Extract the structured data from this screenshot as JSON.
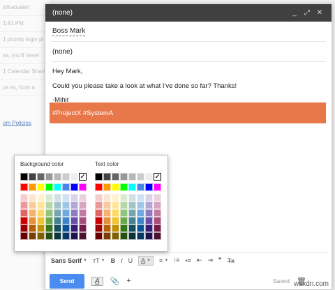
{
  "background": {
    "rows": [
      "Whatsalert",
      "1:41 PM",
      "1 pcomp login pl",
      "ss, you'll never",
      "1 Calendar Share",
      "ps ss, from a"
    ],
    "link": "om Policies"
  },
  "compose": {
    "title": "(none)",
    "to": "Boss Mark",
    "subject": "(none)",
    "body": [
      "Hey Mark,",
      "Could you please take a look at what I've done so far? Thanks!",
      "-Mihir"
    ],
    "highlighted_line": "#ProjectX #SystemA",
    "highlight_color": "#e8774a",
    "window_buttons": [
      "_",
      "⤢",
      "✕"
    ]
  },
  "picker": {
    "background_label": "Background color",
    "text_label": "Text color",
    "grays": [
      "#000000",
      "#434343",
      "#666666",
      "#999999",
      "#b7b7b7",
      "#cccccc",
      "#eeeeee",
      "CHECK"
    ],
    "text_grays": [
      "#000000",
      "#434343",
      "#666666",
      "#999999",
      "#b7b7b7",
      "#cccccc",
      "#eeeeee",
      "CHECK"
    ],
    "bright": [
      "#ff0000",
      "#ff9900",
      "#ffff00",
      "#00ff00",
      "#00ffff",
      "#4a86e8",
      "#0000ff",
      "#ff00ff"
    ],
    "shades": [
      [
        "#f4cccc",
        "#fce5cd",
        "#fff2cc",
        "#d9ead3",
        "#d0e0e3",
        "#cfe2f3",
        "#d9d2e9",
        "#ead1dc"
      ],
      [
        "#ea9999",
        "#f9cb9c",
        "#ffe599",
        "#b6d7a8",
        "#a2c4c9",
        "#9fc5e8",
        "#b4a7d6",
        "#d5a6bd"
      ],
      [
        "#e06666",
        "#f6b26b",
        "#ffd966",
        "#93c47d",
        "#76a5af",
        "#6fa8dc",
        "#8e7cc3",
        "#c27ba0"
      ],
      [
        "#cc0000",
        "#e69138",
        "#f1c232",
        "#6aa84f",
        "#45818e",
        "#3d85c6",
        "#674ea7",
        "#a64d79"
      ],
      [
        "#990000",
        "#b45f06",
        "#bf9000",
        "#38761d",
        "#134f5c",
        "#0b5394",
        "#351c75",
        "#741b47"
      ],
      [
        "#660000",
        "#783f04",
        "#7f6000",
        "#274e13",
        "#0c343d",
        "#073763",
        "#20124d",
        "#4c1130"
      ]
    ]
  },
  "toolbar": {
    "font": "Sans Serif",
    "size_icon": "тT",
    "bold": "B",
    "italic": "I",
    "underline": "U",
    "text_color": "A",
    "align": "≡",
    "numbered": "⁝≡",
    "bulleted": "•≡",
    "indent_less": "⇤",
    "indent_more": "⇥",
    "quote": "❞",
    "clear": "Tx"
  },
  "bottom": {
    "send": "Send",
    "format_icon": "A",
    "attach_icon": "📎",
    "plus_icon": "+",
    "saved": "Saved",
    "trash_icon": "🗑",
    "watermark": "wsxdn.com"
  }
}
